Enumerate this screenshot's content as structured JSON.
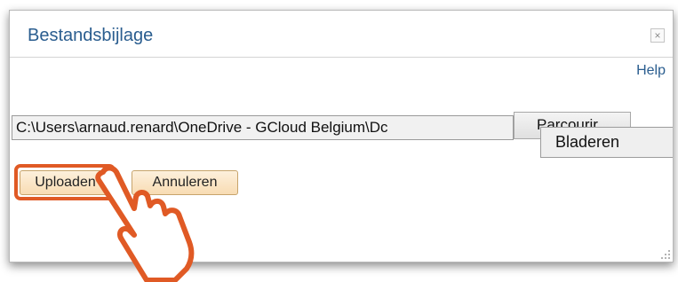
{
  "dialog": {
    "title": "Bestandsbijlage",
    "close_label": "×",
    "help_label": "Help"
  },
  "file_input": {
    "path_value": "C:\\Users\\arnaud.renard\\OneDrive - GCloud Belgium\\Dc",
    "browse_button_label": "Parcourir...",
    "browse_tooltip": "Bladeren"
  },
  "actions": {
    "upload_label": "Uploaden",
    "cancel_label": "Annuleren"
  },
  "colors": {
    "title": "#2a5d8f",
    "button_fill": "#f8dcb3",
    "highlight": "#e05a25"
  },
  "icons": {
    "close": "close-icon",
    "resize": "resize-grip-icon",
    "cursor": "hand-pointer-icon"
  }
}
